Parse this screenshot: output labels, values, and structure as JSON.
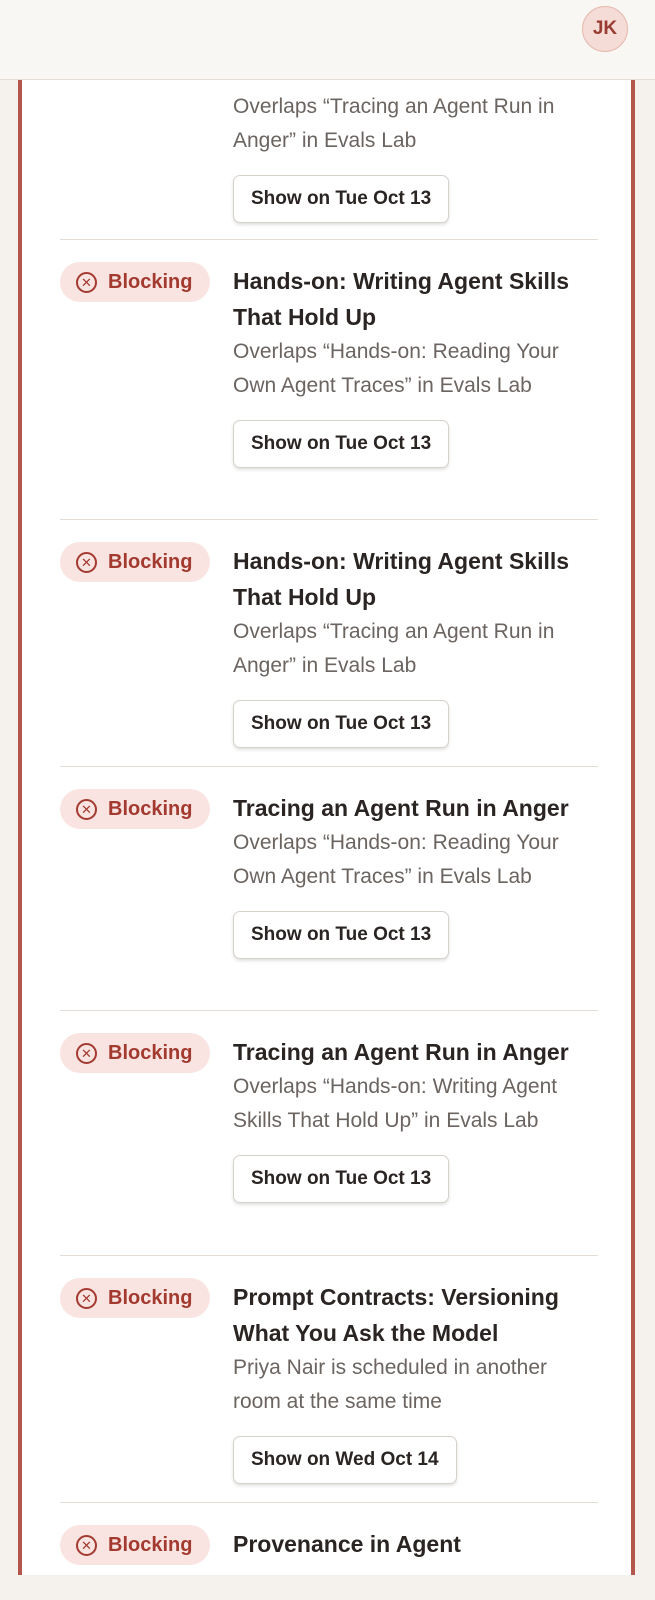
{
  "header": {
    "avatar_initials": "JK"
  },
  "top_partial": {
    "desc": "Overlaps “Tracing an Agent Run in Anger” in Evals Lab",
    "button": "Show on Tue Oct 13"
  },
  "conflicts": [
    {
      "badge": "Blocking",
      "title": "Hands-on: Writing Agent Skills That Hold Up",
      "desc": "Overlaps “Hands-on: Reading Your Own Agent Traces” in Evals Lab",
      "button": "Show on Tue Oct 13"
    },
    {
      "badge": "Blocking",
      "title": "Hands-on: Writing Agent Skills That Hold Up",
      "desc": "Overlaps “Tracing an Agent Run in Anger” in Evals Lab",
      "button": "Show on Tue Oct 13"
    },
    {
      "badge": "Blocking",
      "title": "Tracing an Agent Run in Anger",
      "desc": "Overlaps “Hands-on: Reading Your Own Agent Traces” in Evals Lab",
      "button": "Show on Tue Oct 13"
    },
    {
      "badge": "Blocking",
      "title": "Tracing an Agent Run in Anger",
      "desc": "Overlaps “Hands-on: Writing Agent Skills That Hold Up” in Evals Lab",
      "button": "Show on Tue Oct 13"
    },
    {
      "badge": "Blocking",
      "title": "Prompt Contracts: Versioning What You Ask the Model",
      "desc": "Priya Nair is scheduled in another room at the same time",
      "button": "Show on Wed Oct 14"
    },
    {
      "badge": "Blocking",
      "title": "Provenance in Agent",
      "desc": "",
      "button": ""
    }
  ],
  "colors": {
    "accent": "#b4564c",
    "badge_bg": "#f9e4e1",
    "badge_text": "#a33a30"
  }
}
